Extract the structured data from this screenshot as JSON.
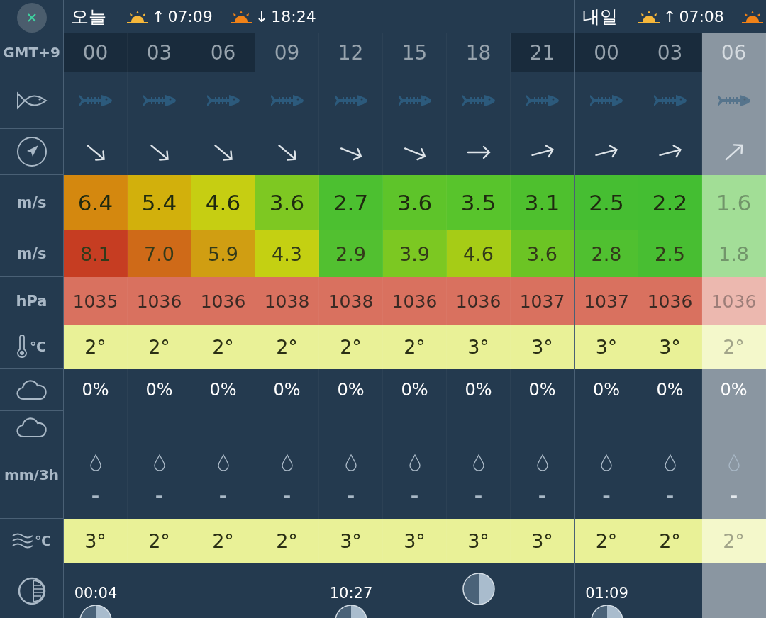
{
  "labels": {
    "timezone": "GMT+9",
    "wind_unit": "m/s",
    "gust_unit": "m/s",
    "pressure_unit": "hPa",
    "temp_unit": "℃",
    "rain_unit": "mm/3h",
    "water_unit": "℃"
  },
  "days": [
    {
      "label": "오늘",
      "events": [
        {
          "kind": "sunrise",
          "arrow": "↑",
          "time": "07:09"
        },
        {
          "kind": "sunset",
          "arrow": "↓",
          "time": "18:24"
        }
      ],
      "columns": [
        {
          "hour": "00",
          "night": true,
          "selected": false,
          "wind_arrow": {
            "kind": "se"
          },
          "wind": {
            "value": "6.4",
            "color": "#d4880f"
          },
          "gust": {
            "value": "8.1",
            "color": "#c63d22"
          },
          "pressure": "1035",
          "temp": "2°",
          "cloud": "0%",
          "rain": "–",
          "water_temp": "3°",
          "moon": {
            "kind": "event",
            "time": "00:04"
          }
        },
        {
          "hour": "03",
          "night": true,
          "selected": false,
          "wind_arrow": {
            "kind": "se"
          },
          "wind": {
            "value": "5.4",
            "color": "#d2b00c"
          },
          "gust": {
            "value": "7.0",
            "color": "#cf6a18"
          },
          "pressure": "1036",
          "temp": "2°",
          "cloud": "0%",
          "rain": "–",
          "water_temp": "2°"
        },
        {
          "hour": "06",
          "night": true,
          "selected": false,
          "wind_arrow": {
            "kind": "se"
          },
          "wind": {
            "value": "4.6",
            "color": "#c6ce12"
          },
          "gust": {
            "value": "5.9",
            "color": "#d09e12"
          },
          "pressure": "1036",
          "temp": "2°",
          "cloud": "0%",
          "rain": "–",
          "water_temp": "2°"
        },
        {
          "hour": "09",
          "night": false,
          "selected": false,
          "wind_arrow": {
            "kind": "se"
          },
          "wind": {
            "value": "3.6",
            "color": "#7ec822"
          },
          "gust": {
            "value": "4.3",
            "color": "#c4d012"
          },
          "pressure": "1038",
          "temp": "2°",
          "cloud": "0%",
          "rain": "–",
          "water_temp": "2°"
        },
        {
          "hour": "12",
          "night": false,
          "selected": false,
          "wind_arrow": {
            "kind": "ese"
          },
          "wind": {
            "value": "2.7",
            "color": "#4cc030"
          },
          "gust": {
            "value": "2.9",
            "color": "#52c030"
          },
          "pressure": "1038",
          "temp": "2°",
          "cloud": "0%",
          "rain": "–",
          "water_temp": "3°",
          "moon": {
            "kind": "event",
            "time": "10:27"
          }
        },
        {
          "hour": "15",
          "night": false,
          "selected": false,
          "wind_arrow": {
            "kind": "ese"
          },
          "wind": {
            "value": "3.6",
            "color": "#5ec42a"
          },
          "gust": {
            "value": "3.9",
            "color": "#7cc822"
          },
          "pressure": "1036",
          "temp": "2°",
          "cloud": "0%",
          "rain": "–",
          "water_temp": "3°"
        },
        {
          "hour": "18",
          "night": false,
          "selected": false,
          "wind_arrow": {
            "kind": "e"
          },
          "wind": {
            "value": "3.5",
            "color": "#58c42c"
          },
          "gust": {
            "value": "4.6",
            "color": "#a6cc16"
          },
          "pressure": "1036",
          "temp": "3°",
          "cloud": "0%",
          "rain": "–",
          "water_temp": "3°",
          "moon": {
            "kind": "phase"
          }
        },
        {
          "hour": "21",
          "night": true,
          "selected": false,
          "wind_arrow": {
            "kind": "ene"
          },
          "wind": {
            "value": "3.1",
            "color": "#4ec02e"
          },
          "gust": {
            "value": "3.6",
            "color": "#6cc424"
          },
          "pressure": "1037",
          "temp": "3°",
          "cloud": "0%",
          "rain": "–",
          "water_temp": "3°"
        }
      ]
    },
    {
      "label": "내일",
      "events": [
        {
          "kind": "sunrise",
          "arrow": "↑",
          "time": "07:08"
        },
        {
          "kind": "sunset"
        }
      ],
      "columns": [
        {
          "hour": "00",
          "night": true,
          "selected": false,
          "wind_arrow": {
            "kind": "ene"
          },
          "wind": {
            "value": "2.5",
            "color": "#46be32"
          },
          "gust": {
            "value": "2.8",
            "color": "#50c030"
          },
          "pressure": "1037",
          "temp": "3°",
          "cloud": "0%",
          "rain": "–",
          "water_temp": "2°",
          "moon": {
            "kind": "event",
            "time": "01:09"
          }
        },
        {
          "hour": "03",
          "night": true,
          "selected": false,
          "wind_arrow": {
            "kind": "ene"
          },
          "wind": {
            "value": "2.2",
            "color": "#44be32"
          },
          "gust": {
            "value": "2.5",
            "color": "#48be32"
          },
          "pressure": "1036",
          "temp": "3°",
          "cloud": "0%",
          "rain": "–",
          "water_temp": "2°"
        },
        {
          "hour": "06",
          "night": false,
          "selected": true,
          "wind_arrow": {
            "kind": "ne"
          },
          "wind": {
            "value": "1.6",
            "color": "#a2de96"
          },
          "gust": {
            "value": "1.8",
            "color": "#a3de98"
          },
          "pressure": "1036",
          "temp": "2°",
          "cloud": "0%",
          "rain": "–",
          "water_temp": "2°"
        }
      ]
    }
  ]
}
